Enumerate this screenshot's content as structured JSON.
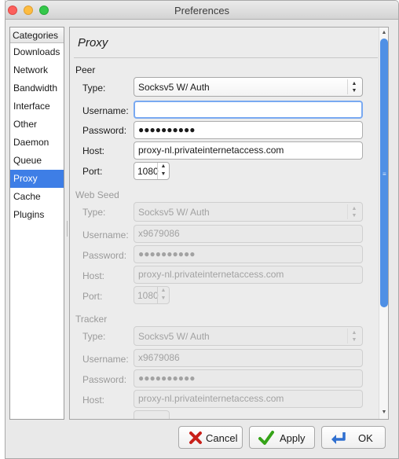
{
  "window": {
    "title": "Preferences"
  },
  "sidebar": {
    "header": "Categories",
    "items": [
      {
        "label": "Downloads",
        "selected": false
      },
      {
        "label": "Network",
        "selected": false
      },
      {
        "label": "Bandwidth",
        "selected": false
      },
      {
        "label": "Interface",
        "selected": false
      },
      {
        "label": "Other",
        "selected": false
      },
      {
        "label": "Daemon",
        "selected": false
      },
      {
        "label": "Queue",
        "selected": false
      },
      {
        "label": "Proxy",
        "selected": true
      },
      {
        "label": "Cache",
        "selected": false
      },
      {
        "label": "Plugins",
        "selected": false
      }
    ]
  },
  "panel": {
    "title": "Proxy",
    "peer": {
      "heading": "Peer",
      "type_label": "Type:",
      "type_value": "Socksv5 W/ Auth",
      "username_label": "Username:",
      "username_value": "",
      "password_label": "Password:",
      "password_value": "●●●●●●●●●●",
      "host_label": "Host:",
      "host_value": "proxy-nl.privateinternetaccess.com",
      "port_label": "Port:",
      "port_value": "1080"
    },
    "web_seed": {
      "heading": "Web Seed",
      "type_label": "Type:",
      "type_value": "Socksv5 W/ Auth",
      "username_label": "Username:",
      "username_value": "x9679086",
      "password_label": "Password:",
      "password_value": "●●●●●●●●●●",
      "host_label": "Host:",
      "host_value": "proxy-nl.privateinternetaccess.com",
      "port_label": "Port:",
      "port_value": "1080"
    },
    "tracker": {
      "heading": "Tracker",
      "type_label": "Type:",
      "type_value": "Socksv5 W/ Auth",
      "username_label": "Username:",
      "username_value": "x9679086",
      "password_label": "Password:",
      "password_value": "●●●●●●●●●●",
      "host_label": "Host:",
      "host_value": "proxy-nl.privateinternetaccess.com"
    }
  },
  "buttons": {
    "cancel": "Cancel",
    "apply": "Apply",
    "ok": "OK"
  },
  "colors": {
    "selection": "#3e7ee6",
    "scroll_thumb": "#4f90e5",
    "focus_ring": "#79a9f1"
  }
}
